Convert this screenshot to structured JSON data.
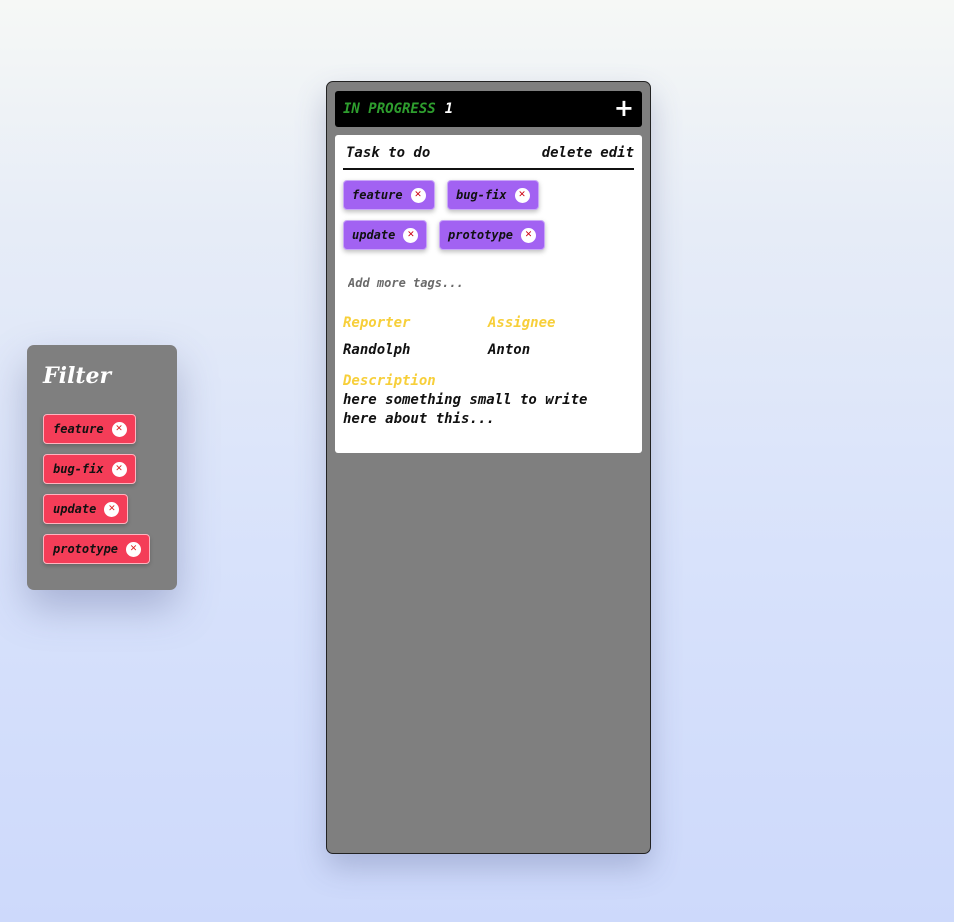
{
  "filter": {
    "title": "Filter",
    "tags": [
      {
        "label": "feature"
      },
      {
        "label": "bug-fix"
      },
      {
        "label": "update"
      },
      {
        "label": "prototype"
      }
    ],
    "tag_color": "#f43d58"
  },
  "column": {
    "title": "IN PROGRESS",
    "count": "1",
    "add_label": "+",
    "title_color": "#2e9e2e",
    "card": {
      "title": "Task to do",
      "delete_label": "delete",
      "edit_label": "edit",
      "tags": [
        {
          "label": "feature"
        },
        {
          "label": "bug-fix"
        },
        {
          "label": "update"
        },
        {
          "label": "prototype"
        }
      ],
      "tag_color": "#a262f2",
      "tag_input_placeholder": "Add more tags...",
      "reporter_label": "Reporter",
      "reporter_value": "Randolph",
      "assignee_label": "Assignee",
      "assignee_value": "Anton",
      "description_label": "Description",
      "description_value": "here something small to write here about this...",
      "label_color": "#f7cf3a"
    }
  }
}
